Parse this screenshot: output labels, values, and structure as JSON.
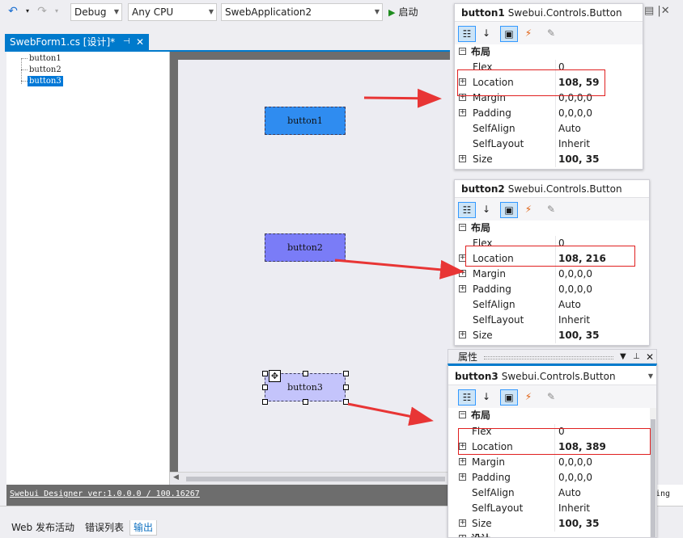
{
  "toolbar": {
    "config": "Debug",
    "platform": "Any CPU",
    "project": "SwebApplication2",
    "run_label": "启动"
  },
  "document_tab": {
    "title": "SwebForm1.cs [设计]*"
  },
  "tree": {
    "items": [
      "button1",
      "button2",
      "button3"
    ],
    "selected": "button3"
  },
  "designer": {
    "buttons": [
      "button1",
      "button2",
      "button3"
    ]
  },
  "status": {
    "text": "Swebui Designer ver:1.0.0.0 / 100.16267",
    "right_text": "ing"
  },
  "bottom_tabs": [
    "Web 发布活动",
    "错误列表",
    "输出"
  ],
  "bottom_tabs_active": "输出",
  "properties_header": {
    "title": "属性"
  },
  "panels": [
    {
      "name": "button1",
      "type": "Swebui.Controls.Button",
      "category": "布局",
      "rows": [
        {
          "name": "Flex",
          "value": "0",
          "expandable": false,
          "bold": false
        },
        {
          "name": "Location",
          "value": "108, 59",
          "expandable": true,
          "bold": true
        },
        {
          "name": "Margin",
          "value": "0,0,0,0",
          "expandable": true,
          "bold": false
        },
        {
          "name": "Padding",
          "value": "0,0,0,0",
          "expandable": true,
          "bold": false
        },
        {
          "name": "SelfAlign",
          "value": "Auto",
          "expandable": false,
          "bold": false
        },
        {
          "name": "SelfLayout",
          "value": "Inherit",
          "expandable": false,
          "bold": false
        },
        {
          "name": "Size",
          "value": "100, 35",
          "expandable": true,
          "bold": true
        }
      ]
    },
    {
      "name": "button2",
      "type": "Swebui.Controls.Button",
      "category": "布局",
      "rows": [
        {
          "name": "Flex",
          "value": "0",
          "expandable": false,
          "bold": false
        },
        {
          "name": "Location",
          "value": "108, 216",
          "expandable": true,
          "bold": true
        },
        {
          "name": "Margin",
          "value": "0,0,0,0",
          "expandable": true,
          "bold": false
        },
        {
          "name": "Padding",
          "value": "0,0,0,0",
          "expandable": true,
          "bold": false
        },
        {
          "name": "SelfAlign",
          "value": "Auto",
          "expandable": false,
          "bold": false
        },
        {
          "name": "SelfLayout",
          "value": "Inherit",
          "expandable": false,
          "bold": false
        },
        {
          "name": "Size",
          "value": "100, 35",
          "expandable": true,
          "bold": true
        }
      ]
    },
    {
      "name": "button3",
      "type": "Swebui.Controls.Button",
      "category": "布局",
      "extra_category": "设计",
      "rows": [
        {
          "name": "Flex",
          "value": "0",
          "expandable": false,
          "bold": false
        },
        {
          "name": "Location",
          "value": "108, 389",
          "expandable": true,
          "bold": true
        },
        {
          "name": "Margin",
          "value": "0,0,0,0",
          "expandable": true,
          "bold": false
        },
        {
          "name": "Padding",
          "value": "0,0,0,0",
          "expandable": true,
          "bold": false
        },
        {
          "name": "SelfAlign",
          "value": "Auto",
          "expandable": false,
          "bold": false
        },
        {
          "name": "SelfLayout",
          "value": "Inherit",
          "expandable": false,
          "bold": false
        },
        {
          "name": "Size",
          "value": "100, 35",
          "expandable": true,
          "bold": true
        }
      ]
    }
  ],
  "colors": {
    "accent": "#007acc",
    "button1": "#2f8cf0",
    "button2": "#7a7cf7",
    "button3": "#c4c4fb",
    "highlight": "#e02020",
    "arrow": "#e83535"
  },
  "icons": {
    "undo": "undo-icon",
    "redo": "redo-icon",
    "run": "play-icon",
    "categorized": "categorized-icon",
    "alphabetical": "sort-alpha-icon",
    "properties": "properties-icon",
    "events": "events-lightning-icon",
    "pages": "wrench-icon"
  }
}
